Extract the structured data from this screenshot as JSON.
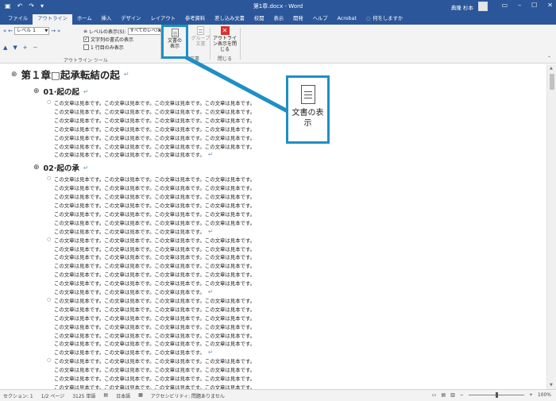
{
  "titlebar": {
    "doc_title": "第1章.docx - Word",
    "user": "典隆 杉本",
    "qa_icons": [
      "save-icon",
      "undo-icon",
      "redo-icon",
      "customize-icon"
    ],
    "win_icons": [
      "ribbon-display-icon",
      "minimize-icon",
      "maximize-icon",
      "close-icon"
    ]
  },
  "tabs": [
    "ファイル",
    "アウトライン",
    "ホーム",
    "挿入",
    "デザイン",
    "レイアウト",
    "参考資料",
    "差し込み文書",
    "校閲",
    "表示",
    "開発",
    "ヘルプ",
    "Acrobat"
  ],
  "tell_me": "何をしますか",
  "ribbon": {
    "level_value": "レベル 1",
    "show_level_label": "レベルの表示(S):",
    "show_level_value": "すべてのレベル",
    "show_formatting": "文字列の書式の表示",
    "show_first_line": "1 行目のみ表示",
    "outline_tools_label": "アウトライン ツール",
    "show_document": "文書の表示",
    "subdocument": "グループ文書",
    "group_document_label": "文書",
    "close_outline": "アウトライン表示を閉じる",
    "close_label": "閉じる"
  },
  "callout": {
    "label": "文書の表示"
  },
  "document": {
    "heading1": "第１章□起承転結の起",
    "sections": [
      {
        "heading": "01·起の起",
        "paragraphs": [
          7
        ]
      },
      {
        "heading": "02·起の承",
        "paragraphs": [
          7,
          7,
          7,
          5
        ]
      }
    ],
    "sentence_line": "この文章は見本です。この文章は見本です。この文章は見本です。この文章は見本です。",
    "short_line": "この文章は見本です。この文章は見本です。この文章は見本です。",
    "para_end": "↵"
  },
  "status": {
    "section": "セクション: 1",
    "page": "1/2 ページ",
    "words": "3125 単語",
    "language": "日本語",
    "accessibility": "アクセシビリティ: 問題ありません",
    "zoom": "100%",
    "zoom_percent": 100
  },
  "colors": {
    "accent": "#2b579a",
    "highlight": "#1f8fc5",
    "close_red": "#d9332b"
  }
}
